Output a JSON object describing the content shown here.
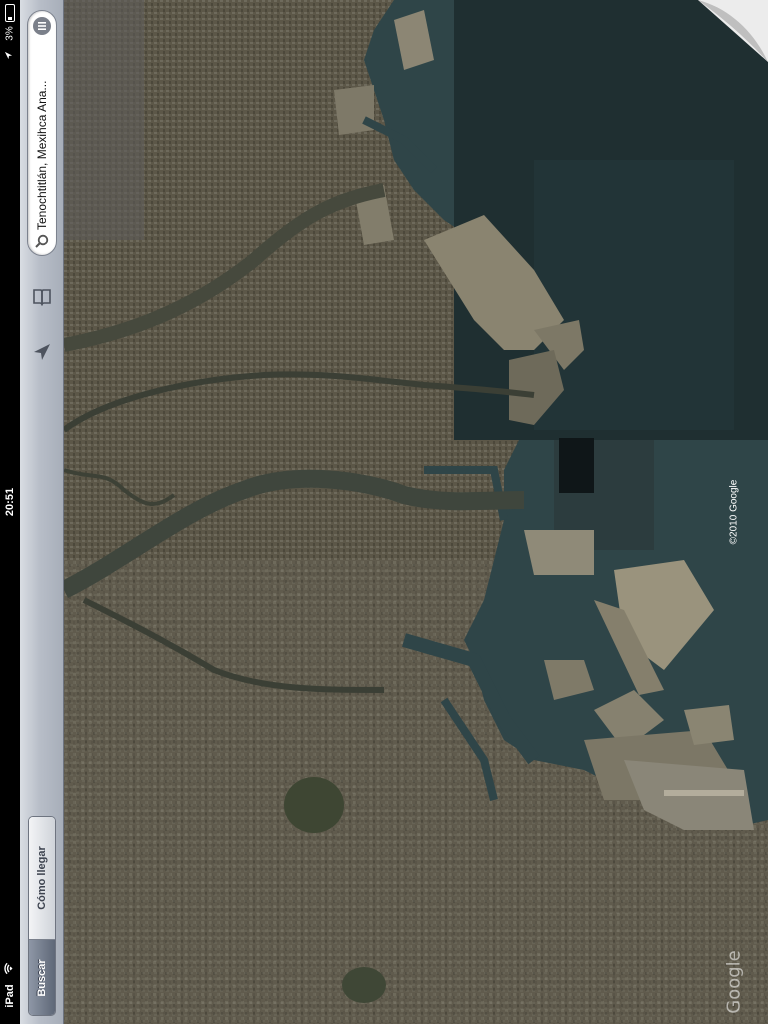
{
  "status_bar": {
    "device": "iPad",
    "wifi_icon": "wifi-icon",
    "time": "20:51",
    "battery_percent": "3%",
    "location_icon": "location-arrow-icon",
    "battery_icon": "battery-icon"
  },
  "toolbar": {
    "segments": {
      "search": "Buscar",
      "directions": "Cómo llegar"
    },
    "selected_segment": "search",
    "locate_icon": "location-arrow-icon",
    "bookmarks_icon": "bookmarks-book-icon",
    "search": {
      "value": "Tenochtitlán, Mexihca Ana...",
      "search_icon": "magnifier-icon",
      "list_icon": "results-list-icon"
    }
  },
  "map": {
    "mode": "satellite",
    "copyright": "©2010 Google",
    "logo": "Google",
    "page_curl_icon": "page-curl-icon",
    "colors": {
      "water": "#2e4547",
      "deep_water": "#1f3033",
      "land": "#595444",
      "urban": "#6f6a5c"
    }
  }
}
